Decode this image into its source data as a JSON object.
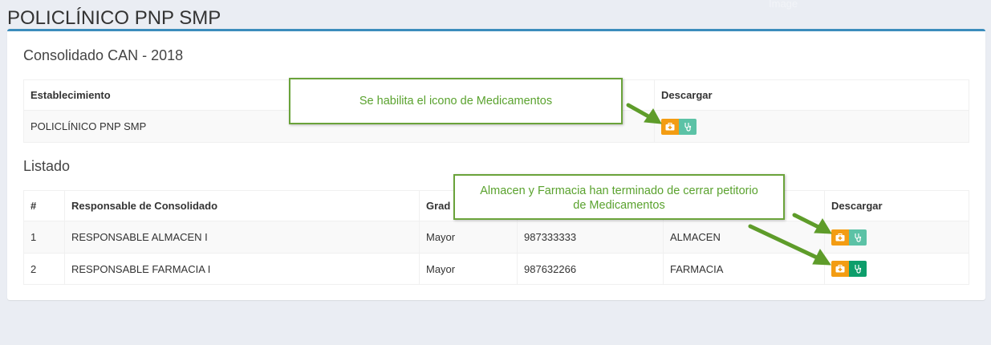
{
  "page": {
    "title": "POLICLÍNICO PNP SMP",
    "ghost_label": "Image"
  },
  "consolidado": {
    "title": "Consolidado CAN - 2018",
    "headers": {
      "establecimiento": "Establecimiento",
      "descargar": "Descargar"
    },
    "row": {
      "establecimiento": "POLICLÍNICO PNP SMP"
    }
  },
  "listado": {
    "title": "Listado",
    "headers": {
      "num": "#",
      "responsable": "Responsable de Consolidado",
      "grado": "Grad",
      "descargar": "Descargar"
    },
    "rows": [
      {
        "num": "1",
        "responsable": "RESPONSABLE ALMACEN I",
        "grado": "Mayor",
        "telefono": "987333333",
        "area": "ALMACEN"
      },
      {
        "num": "2",
        "responsable": "RESPONSABLE FARMACIA I",
        "grado": "Mayor",
        "telefono": "987632266",
        "area": "FARMACIA"
      }
    ]
  },
  "callouts": {
    "medicamentos_icon": "Se habilita el icono de Medicamentos",
    "petitorio_line1": "Almacen y Farmacia han terminado de cerrar petitorio",
    "petitorio_line2": "de  Medicamentos"
  },
  "icons": {
    "download_primary": "medkit-icon",
    "download_secondary": "stethoscope-icon"
  },
  "colors": {
    "accent": "#3c8dbc",
    "orange": "#f39c12",
    "teal": "#5cc2a6",
    "green": "#0d9e6b",
    "callout": "#6aa33a"
  }
}
